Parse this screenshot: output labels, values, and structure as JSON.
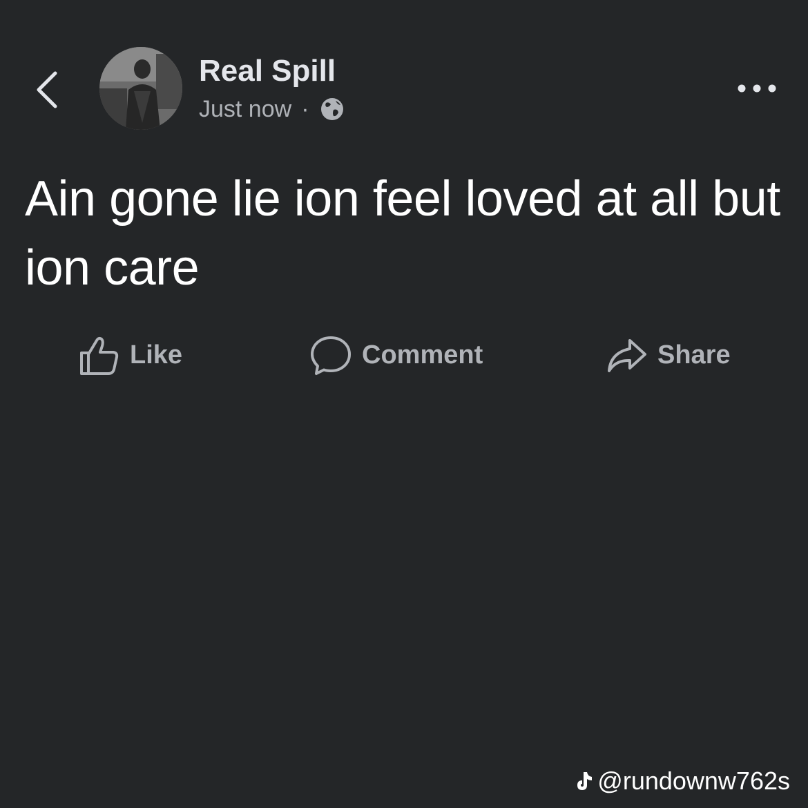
{
  "header": {
    "back_icon": "chevron-left-icon",
    "author_name": "Real Spill",
    "timestamp": "Just now",
    "separator": "·",
    "privacy_icon": "globe-icon",
    "more_icon": "more-horizontal-icon"
  },
  "post": {
    "text": "Ain gone lie ion feel loved at all but ion care"
  },
  "actions": {
    "like_label": "Like",
    "comment_label": "Comment",
    "share_label": "Share"
  },
  "watermark": {
    "icon": "tiktok-icon",
    "handle": "@rundownw762s"
  },
  "colors": {
    "background": "#242628",
    "primary_text": "#ffffff",
    "secondary_text": "#b0b3b8"
  }
}
